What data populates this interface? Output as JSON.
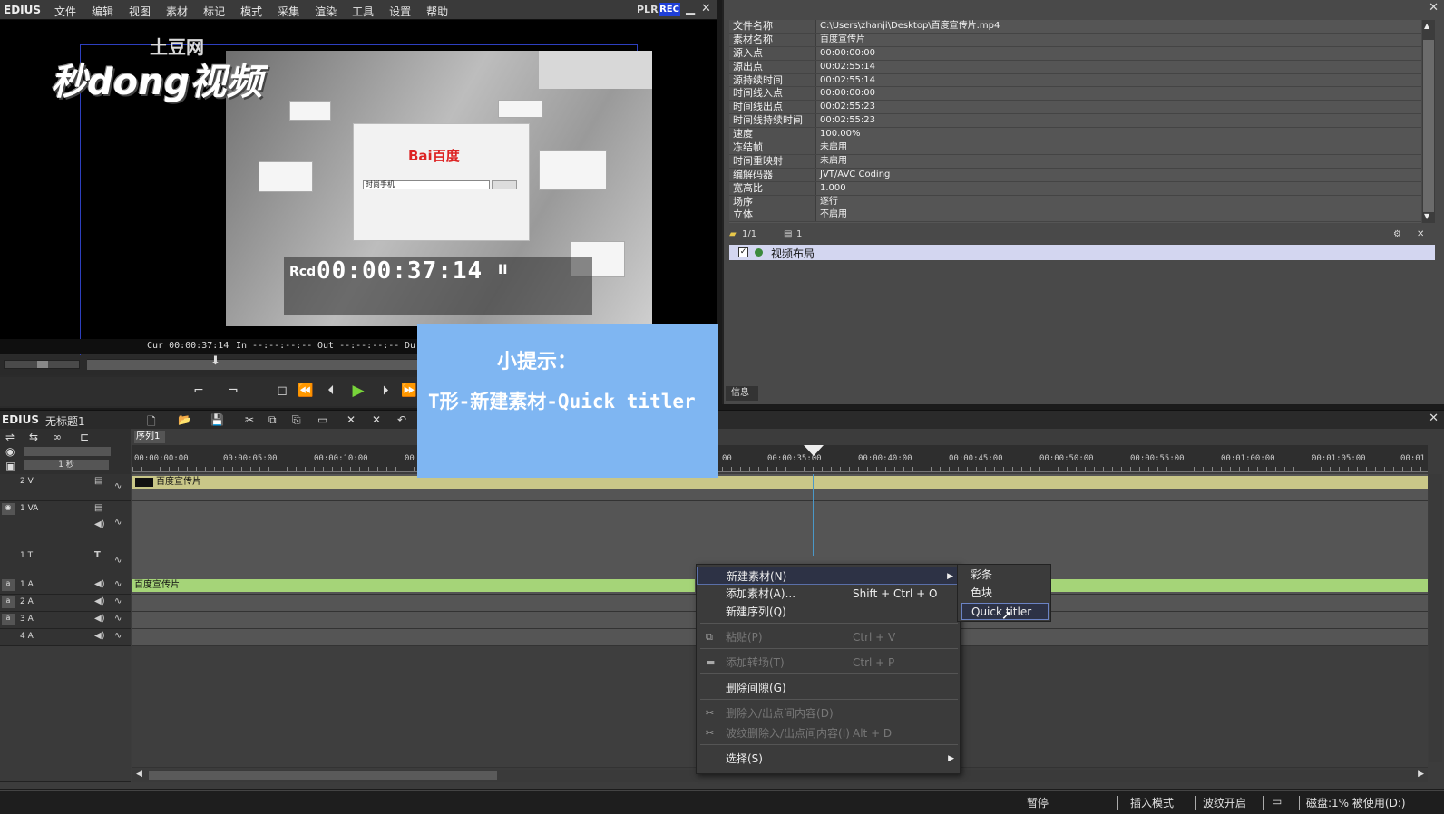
{
  "app": {
    "brand": "EDIUS",
    "menu": [
      "文件",
      "编辑",
      "视图",
      "素材",
      "标记",
      "模式",
      "采集",
      "渲染",
      "工具",
      "设置",
      "帮助"
    ],
    "plr": "PLR",
    "rec": "REC"
  },
  "preview": {
    "watermark_top": "土豆网",
    "watermark_main": "秒dong视频",
    "browser_logo": "Bai百度",
    "browser_search": "时尚手机",
    "rcd": "Rcd",
    "timecode": "00:00:37:14",
    "pause_mark": "II"
  },
  "tc_bar": {
    "cur": "Cur 00:00:37:14",
    "in": "In --:--:--:--",
    "out": "Out --:--:--:--",
    "dur": "Du"
  },
  "properties": [
    {
      "key": "文件名称",
      "value": "C:\\Users\\zhanji\\Desktop\\百度宣传片.mp4"
    },
    {
      "key": "素材名称",
      "value": "百度宣传片"
    },
    {
      "key": "源入点",
      "value": "00:00:00:00"
    },
    {
      "key": "源出点",
      "value": "00:02:55:14"
    },
    {
      "key": "源持续时间",
      "value": "00:02:55:14"
    },
    {
      "key": "时间线入点",
      "value": "00:00:00:00"
    },
    {
      "key": "时间线出点",
      "value": "00:02:55:23"
    },
    {
      "key": "时间线持续时间",
      "value": "00:02:55:23"
    },
    {
      "key": "速度",
      "value": "100.00%"
    },
    {
      "key": "冻结帧",
      "value": "未启用"
    },
    {
      "key": "时间重映射",
      "value": "未启用"
    },
    {
      "key": "编解码器",
      "value": "JVT/AVC Coding"
    },
    {
      "key": "宽高比",
      "value": "1.000"
    },
    {
      "key": "场序",
      "value": "逐行"
    },
    {
      "key": "立体",
      "value": "不启用"
    }
  ],
  "layout_panel": {
    "page": "1/1",
    "count": "1",
    "effect_label": "视频布局",
    "tab": "信息"
  },
  "tip": {
    "line1": "小提示：",
    "line2": "T形-新建素材-Quick titler"
  },
  "timeline": {
    "brand": "EDIUS",
    "project": "无标题1",
    "sequence_tab": "序列1",
    "scale_unit": "1 秒",
    "ruler": [
      "00:00:00:00",
      "00:00:05:00",
      "00:00:10:00",
      "00",
      "00",
      "00:00:35:00",
      "00:00:40:00",
      "00:00:45:00",
      "00:00:50:00",
      "00:00:55:00",
      "00:01:00:00",
      "00:01:05:00",
      "00:01"
    ],
    "tracks": [
      {
        "name": "2 V",
        "kind": "v"
      },
      {
        "name": "1 VA",
        "kind": "va"
      },
      {
        "name": "1 T",
        "kind": "t"
      },
      {
        "name": "1 A",
        "kind": "a"
      },
      {
        "name": "2 A",
        "kind": "a"
      },
      {
        "name": "3 A",
        "kind": "a"
      },
      {
        "name": "4 A",
        "kind": "a"
      }
    ],
    "clip_v": "百度宣传片",
    "clip_a": "百度宣传片"
  },
  "context_menu": {
    "items": [
      {
        "label": "新建素材(N)",
        "shortcut": "",
        "submenu": true,
        "disabled": false
      },
      {
        "label": "添加素材(A)...",
        "shortcut": "Shift + Ctrl + O",
        "submenu": false,
        "disabled": false
      },
      {
        "label": "新建序列(Q)",
        "shortcut": "",
        "submenu": false,
        "disabled": false
      },
      {
        "label": "粘贴(P)",
        "shortcut": "Ctrl + V",
        "submenu": false,
        "disabled": true
      },
      {
        "label": "添加转场(T)",
        "shortcut": "Ctrl + P",
        "submenu": false,
        "disabled": true
      },
      {
        "label": "删除间隙(G)",
        "shortcut": "",
        "submenu": false,
        "disabled": false
      },
      {
        "label": "删除入/出点间内容(D)",
        "shortcut": "",
        "submenu": false,
        "disabled": true
      },
      {
        "label": "波纹删除入/出点间内容(I)",
        "shortcut": "Alt + D",
        "submenu": false,
        "disabled": true
      },
      {
        "label": "选择(S)",
        "shortcut": "",
        "submenu": true,
        "disabled": false
      }
    ],
    "submenu": [
      "彩条",
      "色块",
      "Quick titler"
    ]
  },
  "status": {
    "pause": "暂停",
    "insert_mode": "插入模式",
    "ripple": "波纹开启",
    "disk": "磁盘:1% 被使用(D:)"
  },
  "colors": {
    "accent_blue": "#7fb6f2",
    "play_green": "#78d43a",
    "video_clip": "#c9c788",
    "audio_clip": "#a5d478",
    "rec_blue": "#1f3fd8"
  }
}
